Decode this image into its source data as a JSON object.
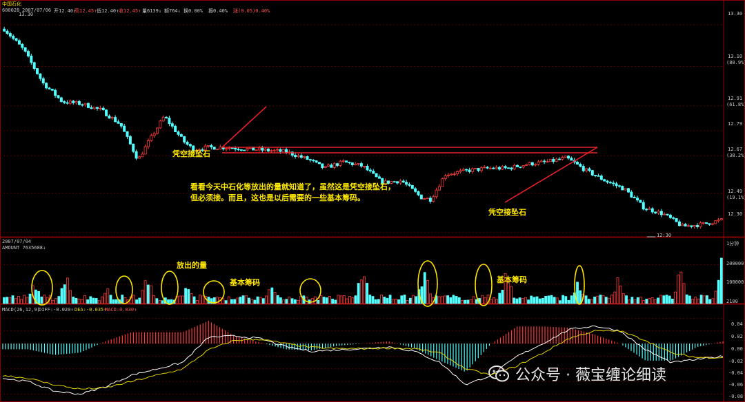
{
  "header": {
    "title": "中国石化",
    "date": "2007/07/06",
    "stock_code": "600028",
    "open": "开12.40↑",
    "high": "高12.45↑",
    "low": "低12.40↑",
    "close": "收12.45↑",
    "volume": "量6139↓",
    "amount": "额764↓",
    "turnover": "换0.00%",
    "amplitude": "振0.40%",
    "change": "涨(0.05)0.40%"
  },
  "price_axis": {
    "ticks": [
      "13.30",
      "13.10",
      "12.91",
      "12.79",
      "12.67",
      "12.49",
      "12.30"
    ],
    "pct_labels": [
      "(80.9%)",
      "(61.8%)",
      "(38.2%)",
      "(19.1%)"
    ]
  },
  "price_marks": {
    "high": "13.30",
    "low": "12:30"
  },
  "volume_panel": {
    "date": "2007/07/04",
    "label": "AMOUNT 7635688↓",
    "right_label": "1分钟",
    "axis_ticks": [
      "200000",
      "100000",
      "2100"
    ]
  },
  "macd_panel": {
    "label": "MACD(26,12,9)",
    "diff": "DIFF:-0.020↑",
    "dea": "DEA:-0.035↑",
    "macd": "MACD:0.030↑",
    "axis_ticks": [
      "0.04",
      "0.02",
      "0.00",
      "-0.02",
      "-0.04",
      "-0.06",
      "-0.08"
    ]
  },
  "annotations": {
    "support_left": "凭空接坠石",
    "support_right": "凭空接坠石",
    "note_line1": "看看今天中石化等放出的量就知道了，虽然这是凭空接坠石，",
    "note_line2": "但必须接。而且，这也是以后需要的一些基本筹码。",
    "volume_release": "放出的量",
    "base_chips_1": "基本筹码",
    "base_chips_2": "基本筹码"
  },
  "watermark": "公众号 · 薇宝缠论细读",
  "colors": {
    "up": "#ff3c3c",
    "down": "#54ffff",
    "trendline": "#e8202a",
    "annotation": "#ffe800",
    "diff_line": "#ffffff",
    "dea_line": "#e6d800",
    "grid": "#5a0000"
  },
  "chart_data": [
    {
      "type": "candlestick",
      "title": "中国石化 600028 1分钟",
      "y_ticks": [
        13.3,
        13.1,
        12.91,
        12.79,
        12.67,
        12.49,
        12.3
      ],
      "ylim": [
        12.28,
        13.36
      ],
      "x_count": 240,
      "high": 13.3,
      "low": 12.3,
      "close": 12.45,
      "keypoints": [
        [
          0,
          13.28
        ],
        [
          20,
          13.18
        ],
        [
          40,
          13.02
        ],
        [
          60,
          12.93
        ],
        [
          80,
          12.92
        ],
        [
          100,
          12.89
        ],
        [
          120,
          12.82
        ],
        [
          138,
          12.65
        ],
        [
          148,
          12.73
        ],
        [
          165,
          12.86
        ],
        [
          185,
          12.74
        ],
        [
          195,
          12.7
        ],
        [
          210,
          12.71
        ],
        [
          230,
          12.71
        ],
        [
          260,
          12.7
        ],
        [
          290,
          12.69
        ],
        [
          315,
          12.65
        ],
        [
          330,
          12.61
        ],
        [
          350,
          12.64
        ],
        [
          370,
          12.62
        ],
        [
          390,
          12.54
        ],
        [
          410,
          12.55
        ],
        [
          430,
          12.47
        ],
        [
          440,
          12.46
        ],
        [
          455,
          12.58
        ],
        [
          480,
          12.6
        ],
        [
          500,
          12.61
        ],
        [
          520,
          12.61
        ],
        [
          540,
          12.63
        ],
        [
          560,
          12.64
        ],
        [
          580,
          12.66
        ],
        [
          600,
          12.6
        ],
        [
          620,
          12.55
        ],
        [
          640,
          12.51
        ],
        [
          660,
          12.42
        ],
        [
          680,
          12.39
        ],
        [
          700,
          12.33
        ],
        [
          720,
          12.34
        ],
        [
          740,
          12.36
        ]
      ]
    },
    {
      "type": "bar",
      "title": "AMOUNT",
      "y_ticks": [
        200000,
        100000,
        2100
      ],
      "ylim": [
        0,
        280000
      ],
      "peaks": [
        [
          30,
          130000
        ],
        [
          60,
          180000
        ],
        [
          100,
          100000
        ],
        [
          140,
          170000
        ],
        [
          180,
          120000
        ],
        [
          260,
          120000
        ],
        [
          350,
          220000
        ],
        [
          410,
          190000
        ],
        [
          490,
          190000
        ],
        [
          560,
          130000
        ],
        [
          600,
          160000
        ],
        [
          660,
          210000
        ],
        [
          700,
          280000
        ]
      ]
    },
    {
      "type": "line",
      "title": "MACD(26,12,9)",
      "series": [
        {
          "name": "DIFF",
          "values": [
            -0.055,
            -0.06,
            -0.075,
            -0.08,
            -0.068,
            -0.05,
            -0.04,
            -0.03,
            0.01,
            0.012,
            0.008,
            -0.005,
            -0.012,
            -0.01,
            -0.008,
            -0.005,
            -0.012,
            -0.03,
            -0.065,
            -0.05,
            -0.02,
            0.0,
            0.022,
            0.028,
            0.02,
            -0.01,
            -0.03,
            -0.025,
            -0.02
          ]
        },
        {
          "name": "DEA",
          "values": [
            -0.05,
            -0.055,
            -0.065,
            -0.072,
            -0.07,
            -0.06,
            -0.05,
            -0.04,
            -0.01,
            0.005,
            0.007,
            0.0,
            -0.006,
            -0.008,
            -0.008,
            -0.007,
            -0.008,
            -0.015,
            -0.04,
            -0.05,
            -0.035,
            -0.015,
            0.008,
            0.02,
            0.02,
            0.005,
            -0.015,
            -0.022,
            -0.022
          ]
        }
      ],
      "y_ticks": [
        0.04,
        0.02,
        0.0,
        -0.02,
        -0.04,
        -0.06,
        -0.08
      ],
      "ylim": [
        -0.088,
        0.048
      ]
    }
  ]
}
